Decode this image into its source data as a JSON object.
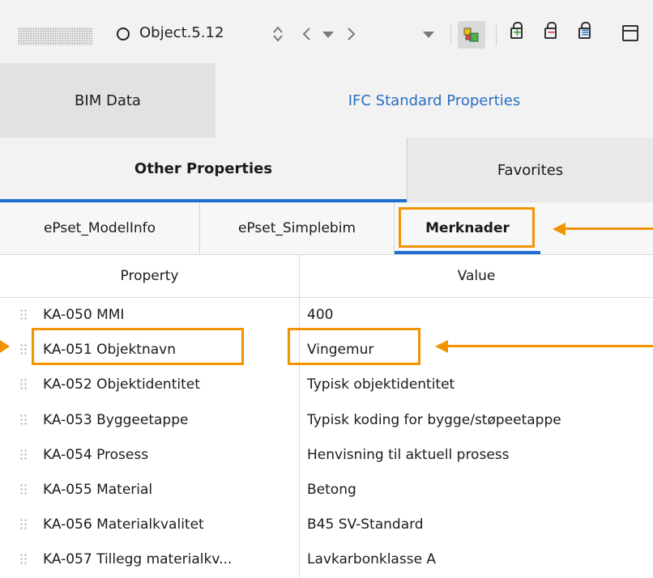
{
  "toolbar": {
    "object_name": "Object.5.12",
    "icons": [
      "grip-handle-icon",
      "object-circle-icon",
      "sort-icon",
      "chevron-left-icon",
      "dropdown-triangle-icon",
      "chevron-right-icon",
      "dropdown-triangle-icon",
      "cube-view-icon",
      "lock-add-icon",
      "lock-remove-icon",
      "lock-list-icon",
      "panel-icon"
    ]
  },
  "tabs_primary": {
    "bim_data": "BIM Data",
    "ifc_standard": "IFC Standard Properties"
  },
  "tabs_secondary": {
    "other": "Other Properties",
    "favorites": "Favorites"
  },
  "pset_tabs": [
    "ePset_ModelInfo",
    "ePset_Simplebim",
    "Merknader"
  ],
  "table": {
    "headers": {
      "property": "Property",
      "value": "Value"
    },
    "rows": [
      {
        "property": "KA-050 MMI",
        "value": "400"
      },
      {
        "property": "KA-051 Objektnavn",
        "value": "Vingemur"
      },
      {
        "property": "KA-052 Objektidentitet",
        "value": "Typisk objektidentitet"
      },
      {
        "property": "KA-053 Byggeetappe",
        "value": "Typisk koding for bygge/støpeetappe"
      },
      {
        "property": "KA-054 Prosess",
        "value": "Henvisning til aktuell prosess"
      },
      {
        "property": "KA-055 Material",
        "value": "Betong"
      },
      {
        "property": "KA-056 Materialkvalitet",
        "value": "B45 SV-Standard"
      },
      {
        "property": "KA-057 Tillegg materialkv...",
        "value": "Lavkarbonklasse A"
      }
    ]
  },
  "colors": {
    "accent_blue": "#1f6fd1",
    "link_blue": "#2a6fc4",
    "highlight_orange": "#f29300"
  }
}
